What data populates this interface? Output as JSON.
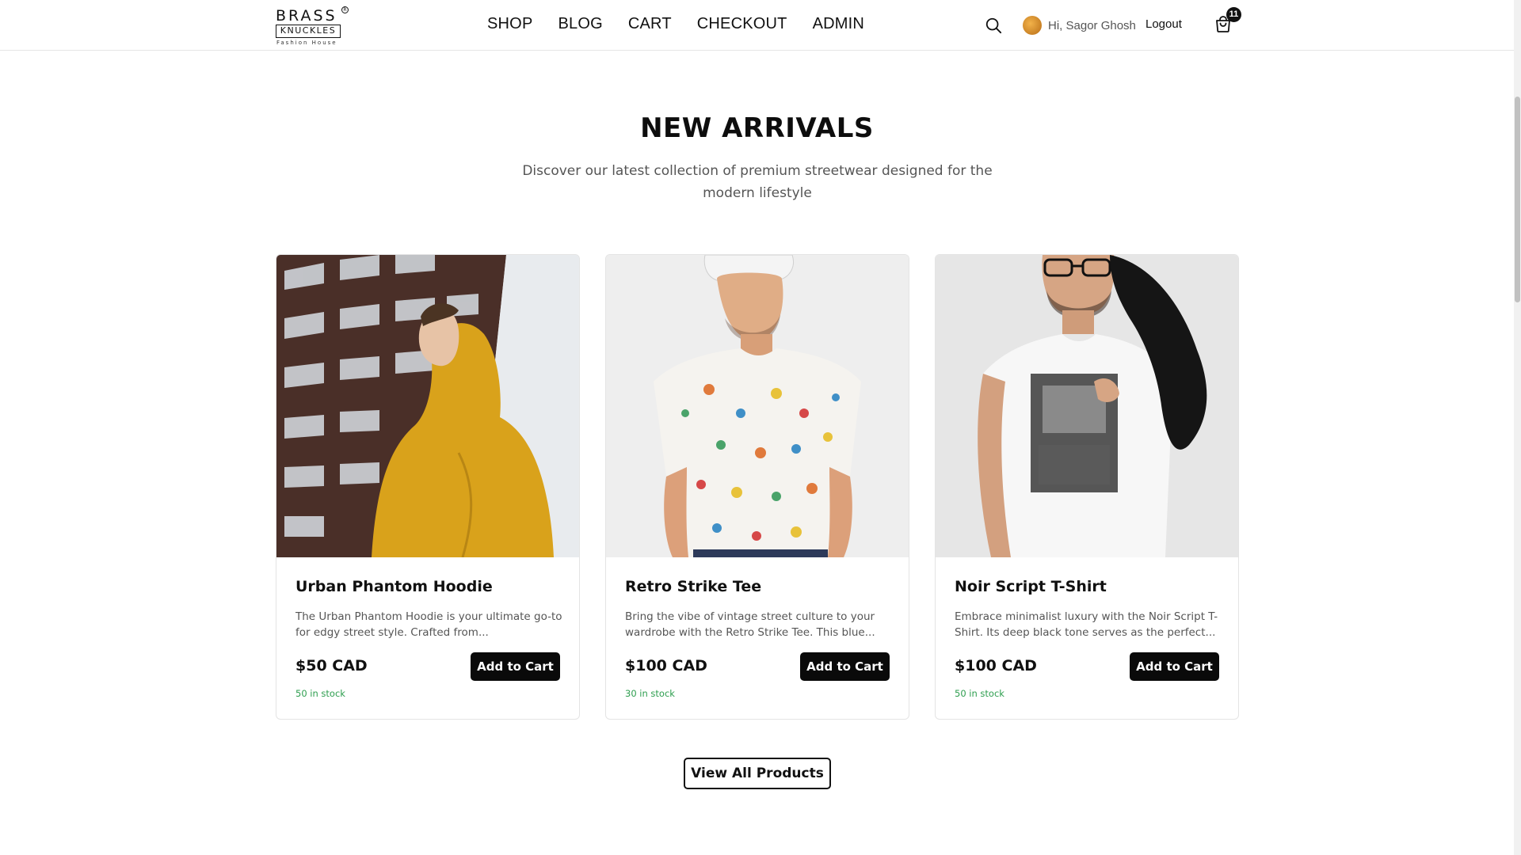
{
  "brand": {
    "line1": "BRASS",
    "line2": "KNUCKLES",
    "line3": "Fashion House",
    "reg": "R"
  },
  "nav": {
    "items": [
      {
        "label": "SHOP"
      },
      {
        "label": "BLOG"
      },
      {
        "label": "CART"
      },
      {
        "label": "CHECKOUT"
      },
      {
        "label": "ADMIN"
      }
    ]
  },
  "user": {
    "greeting": "Hi, Sagor Ghosh",
    "logout": "Logout",
    "cart_count": "11"
  },
  "icons": {
    "search": "search-icon",
    "cart": "shopping-bag-icon"
  },
  "section": {
    "title": "NEW ARRIVALS",
    "subtitle": "Discover our latest collection of premium streetwear designed for the modern lifestyle"
  },
  "products": [
    {
      "name": "Urban Phantom Hoodie",
      "description": "The Urban Phantom Hoodie is your ultimate go-to for edgy street style. Crafted from...",
      "price": "$50 CAD",
      "button": "Add to Cart",
      "stock": "50 in stock"
    },
    {
      "name": "Retro Strike Tee",
      "description": "Bring the vibe of vintage street culture to your wardrobe with the Retro Strike Tee. This blue...",
      "price": "$100 CAD",
      "button": "Add to Cart",
      "stock": "30 in stock"
    },
    {
      "name": "Noir Script T-Shirt",
      "description": "Embrace minimalist luxury with the Noir Script T-Shirt. Its deep black tone serves as the perfect...",
      "price": "$100 CAD",
      "button": "Add to Cart",
      "stock": "50 in stock"
    }
  ],
  "cta": {
    "view_all": "View All Products"
  },
  "colors": {
    "accent": "#0a0a0a",
    "stock_green": "#2e9e4f",
    "hoodie_yellow": "#d9a21b"
  }
}
